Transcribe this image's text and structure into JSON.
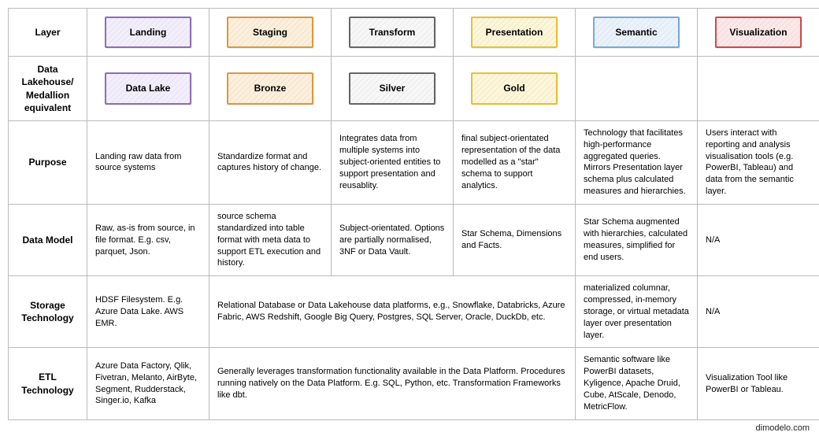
{
  "rows": {
    "layer": "Layer",
    "equiv": "Data Lakehouse/ Medallion equivalent",
    "purpose": "Purpose",
    "model": "Data Model",
    "storage": "Storage Technology",
    "etl": "ETL Technology"
  },
  "layers": {
    "landing": "Landing",
    "staging": "Staging",
    "transform": "Transform",
    "presentation": "Presentation",
    "semantic": "Semantic",
    "visualization": "Visualization"
  },
  "equiv": {
    "landing": "Data Lake",
    "staging": "Bronze",
    "transform": "Silver",
    "presentation": "Gold"
  },
  "purpose": {
    "landing": "Landing raw data from source systems",
    "staging": "Standardize format and captures history of change.",
    "transform": "Integrates data from multiple systems into subject-oriented entities to support presentation and reusablity.",
    "presentation": "final subject-orientated representation of the data modelled as a \"star\" schema to support analytics.",
    "semantic": "Technology that facilitates high-performance aggregated queries. Mirrors Presentation layer schema plus calculated measures and hierarchies.",
    "visualization": "Users interact with reporting and analysis visualisation tools (e.g. PowerBI, Tableau) and data from the semantic layer."
  },
  "model": {
    "landing": "Raw, as-is from source, in file format. E.g. csv, parquet, Json.",
    "staging": "source schema standardized into table format with meta data to support ETL execution and history.",
    "transform": "Subject-orientated. Options are partially normalised, 3NF or Data Vault.",
    "presentation": "Star Schema, Dimensions and Facts.",
    "semantic": "Star Schema augmented with hierarchies, calculated measures, simplified for end users.",
    "visualization": "N/A"
  },
  "storage": {
    "landing": "HDSF Filesystem. E.g. Azure Data Lake. AWS EMR.",
    "shared": "Relational Database or Data Lakehouse data platforms, e.g., Snowflake, Databricks, Azure Fabric, AWS Redshift, Google Big Query, Postgres, SQL Server, Oracle, DuckDb, etc.",
    "semantic": "materialized columnar, compressed, in-memory storage, or virtual metadata layer over presentation layer.",
    "visualization": "N/A"
  },
  "etl": {
    "landing": "Azure Data Factory, Qlik, Fivetran, Melanto, AirByte, Segment, Rudderstack, Singer.io, Kafka",
    "shared": "Generally leverages transformation functionality available in the Data Platform. Procedures running natively on the Data Platform. E.g. SQL, Python, etc. Transformation Frameworks like dbt.",
    "semantic": "Semantic software like PowerBI datasets, Kyligence, Apache Druid, Cube, AtScale, Denodo, MetricFlow.",
    "visualization": "Visualization Tool like PowerBI or Tableau."
  },
  "credit": "dimodelo.com"
}
